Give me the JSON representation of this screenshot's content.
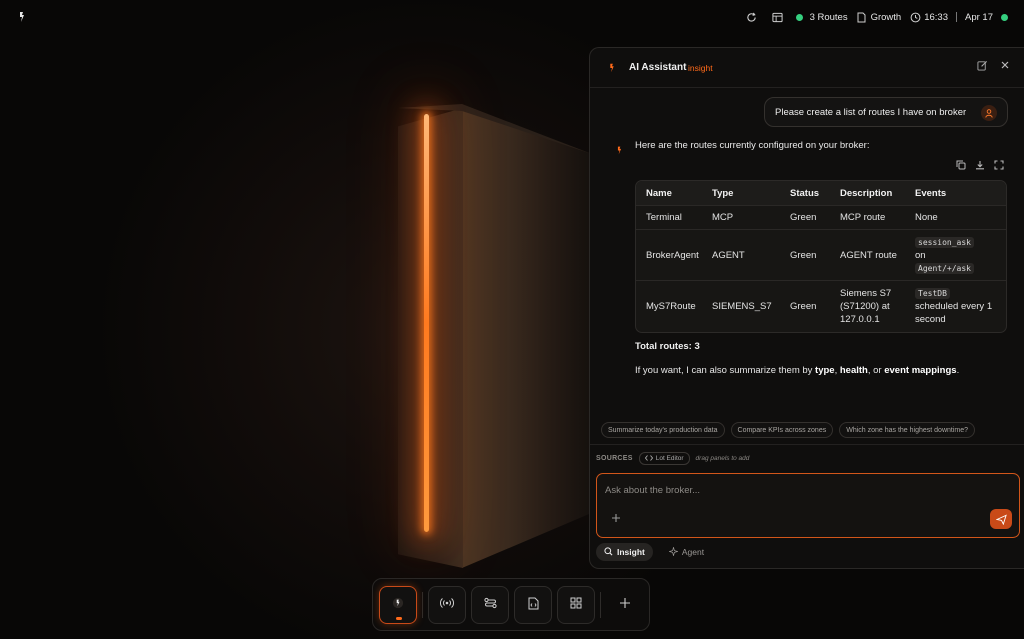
{
  "topbar": {
    "routes_label": "3 Routes",
    "workspace_label": "Growth",
    "time": "16:33",
    "date": "Apr 17",
    "status_color": "#35d07f"
  },
  "assistant": {
    "title": "AI Assistant",
    "mode_badge": "insight",
    "user_message": "Please create a list of routes I have on broker",
    "bot_intro": "Here are the routes currently configured on your broker:",
    "table": {
      "headers": [
        "Name",
        "Type",
        "Status",
        "Description",
        "Events"
      ],
      "rows": [
        {
          "name": "Terminal",
          "type": "MCP",
          "status": "Green",
          "description": "MCP route",
          "events_text": "None"
        },
        {
          "name": "BrokerAgent",
          "type": "AGENT",
          "status": "Green",
          "description": "AGENT route",
          "events_code1": "session_ask",
          "events_mid": "on",
          "events_code2": "Agent/+/ask"
        },
        {
          "name": "MyS7Route",
          "type": "SIEMENS_S7",
          "status": "Green",
          "description": "Siemens S7 (S71200) at 127.0.0.1",
          "events_code1": "TestDB",
          "events_tail": "scheduled every 1 second"
        }
      ]
    },
    "total_routes": "Total routes: 3",
    "summary": {
      "prefix": "If you want, I can also summarize them by ",
      "k1": "type",
      "sep1": ", ",
      "k2": "health",
      "sep2": ", or ",
      "k3": "event mappings",
      "suffix": "."
    },
    "suggestions": [
      "Summarize today's production data",
      "Compare KPIs across zones",
      "Which zone has the highest downtime?"
    ],
    "sources_label": "SOURCES",
    "lot_editor": "Lot Editor",
    "drag_hint": "drag panels to add",
    "input_placeholder": "Ask about the broker...",
    "modes": [
      "Insight",
      "Agent"
    ],
    "accent": "#ff6a1a"
  }
}
